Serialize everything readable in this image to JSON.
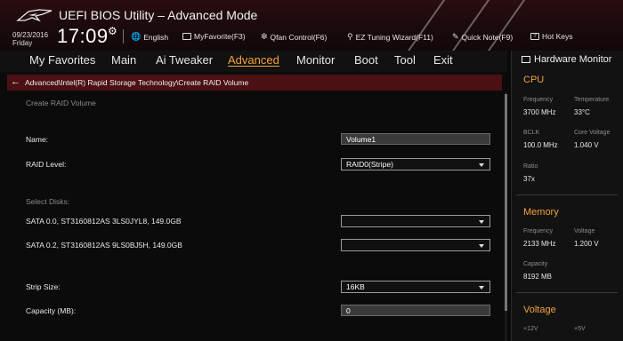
{
  "header": {
    "title": "UEFI BIOS Utility – Advanced Mode",
    "date": "09/23/2016",
    "day": "Friday",
    "time": "17:09",
    "items": [
      {
        "label": "English",
        "icon": "globe-icon"
      },
      {
        "label": "MyFavorite(F3)",
        "icon": "favorite-icon"
      },
      {
        "label": "Qfan Control(F6)",
        "icon": "fan-icon"
      },
      {
        "label": "EZ Tuning Wizard(F11)",
        "icon": "bulb-icon"
      },
      {
        "label": "Quick Note(F9)",
        "icon": "note-icon"
      },
      {
        "label": "Hot Keys",
        "icon": "question-icon"
      }
    ]
  },
  "menu": {
    "items": [
      "My Favorites",
      "Main",
      "Ai Tweaker",
      "Advanced",
      "Monitor",
      "Boot",
      "Tool",
      "Exit"
    ],
    "active": "Advanced"
  },
  "breadcrumb": "Advanced\\Intel(R) Rapid Storage Technology\\Create RAID Volume",
  "form": {
    "section_title": "Create RAID Volume",
    "name_label": "Name:",
    "name_value": "Volume1",
    "raid_level_label": "RAID Level:",
    "raid_level_value": "RAID0(Stripe)",
    "select_disks_label": "Select Disks:",
    "disk1_label": "SATA 0.0, ST3160812AS 3LS0JYL8, 149.0GB",
    "disk1_value": "",
    "disk2_label": "SATA 0.2, ST3160812AS 9LS0BJ5H, 149.0GB",
    "disk2_value": "",
    "strip_size_label": "Strip Size:",
    "strip_size_value": "16KB",
    "capacity_label": "Capacity (MB):",
    "capacity_value": "0"
  },
  "hw_monitor": {
    "title": "Hardware Monitor",
    "cpu": {
      "title": "CPU",
      "frequency_label": "Frequency",
      "frequency_value": "3700 MHz",
      "temperature_label": "Temperature",
      "temperature_value": "33°C",
      "bclk_label": "BCLK",
      "bclk_value": "100.0 MHz",
      "core_voltage_label": "Core Voltage",
      "core_voltage_value": "1.040 V",
      "ratio_label": "Ratio",
      "ratio_value": "37x"
    },
    "memory": {
      "title": "Memory",
      "frequency_label": "Frequency",
      "frequency_value": "2133 MHz",
      "voltage_label": "Voltage",
      "voltage_value": "1.200 V",
      "capacity_label": "Capacity",
      "capacity_value": "8192 MB"
    },
    "voltage": {
      "title": "Voltage",
      "v12_label": "+12V",
      "v5_label": "+5V"
    }
  },
  "colors": {
    "accent": "#f2a33a",
    "breadcrumb_bg": "#4b1014"
  }
}
